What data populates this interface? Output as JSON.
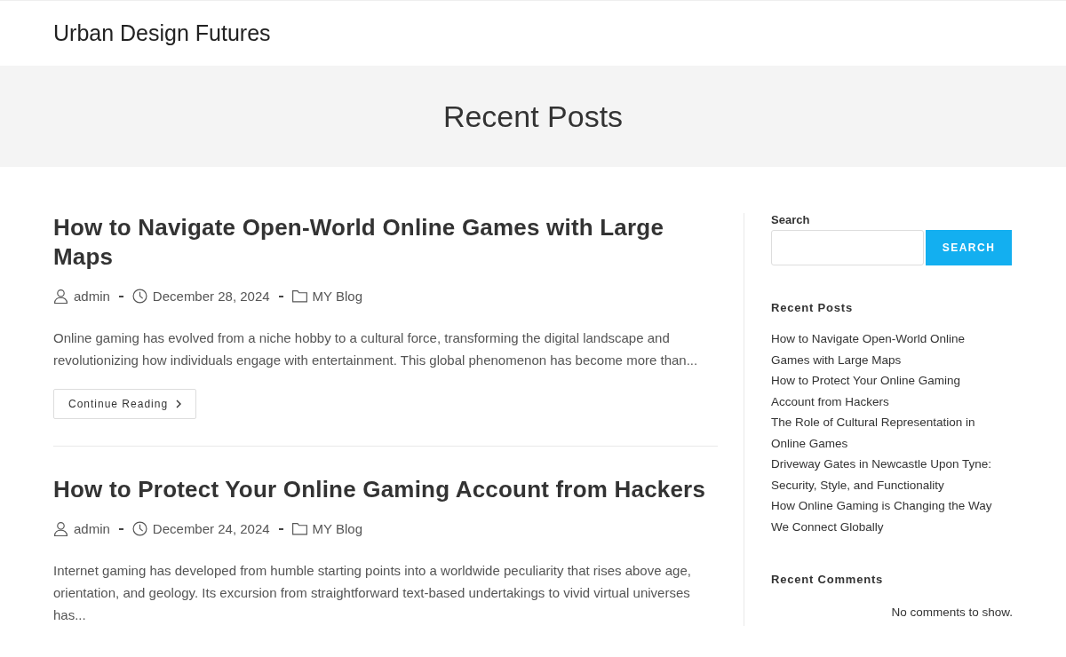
{
  "site": {
    "title": "Urban Design Futures"
  },
  "page_header": {
    "title": "Recent Posts"
  },
  "posts": [
    {
      "title": "How to Navigate Open-World Online Games with Large Maps",
      "author": "admin",
      "date": "December 28, 2024",
      "category": "MY Blog",
      "excerpt": "Online gaming has evolved from a niche hobby to a cultural force, transforming the digital landscape and revolutionizing how individuals engage with entertainment. This global phenomenon has become more than...",
      "button": "Continue Reading"
    },
    {
      "title": "How to Protect Your Online Gaming Account from Hackers",
      "author": "admin",
      "date": "December 24, 2024",
      "category": "MY Blog",
      "excerpt": "Internet gaming has developed from humble starting points into a worldwide peculiarity that rises above age, orientation, and geology. Its excursion from straightforward text-based undertakings to vivid virtual universes has..."
    }
  ],
  "sidebar": {
    "search": {
      "label": "Search",
      "button": "SEARCH"
    },
    "recent_posts": {
      "title": "Recent Posts",
      "items": [
        "How to Navigate Open-World Online Games with Large Maps",
        "How to Protect Your Online Gaming Account from Hackers",
        "The Role of Cultural Representation in Online Games",
        "Driveway Gates in Newcastle Upon Tyne: Security, Style, and Functionality",
        "How Online Gaming is Changing the Way We Connect Globally"
      ]
    },
    "recent_comments": {
      "title": "Recent Comments",
      "empty": "No comments to show."
    }
  }
}
